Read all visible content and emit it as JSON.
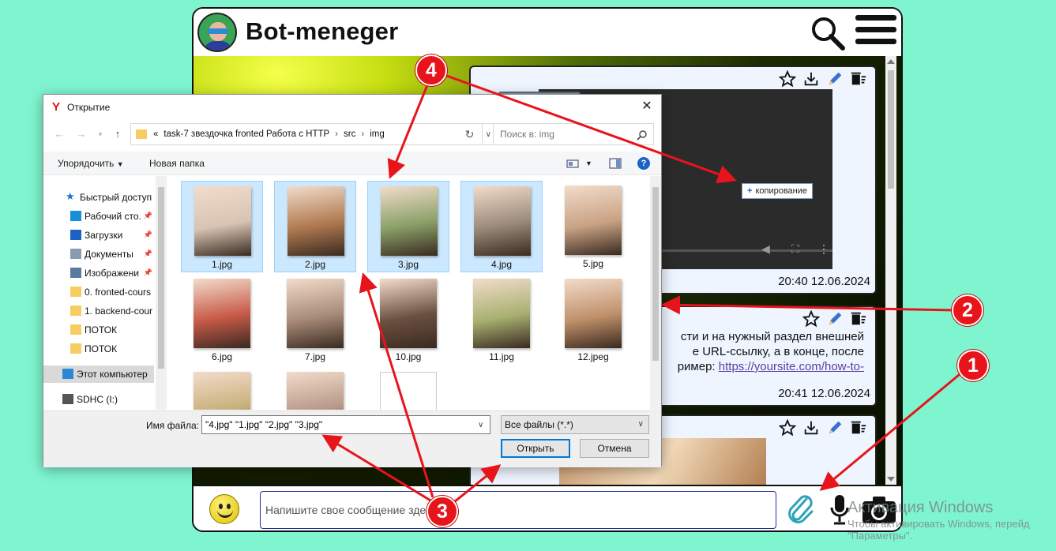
{
  "app": {
    "title": "Bot-meneger",
    "input_placeholder": "Напишите свое сообщение здесь",
    "icons": [
      "search-icon",
      "menu-icon",
      "smiley-icon",
      "paperclip-icon",
      "microphone-icon",
      "camera-icon"
    ]
  },
  "messages": [
    {
      "time": "20:40 12.06.2024",
      "content": "video"
    },
    {
      "text_line1": "сти и на нужный раздел внешней",
      "text_line2": "е URL-ссылку, а в конце, после",
      "text_line3_prefix": "ример: ",
      "text_line3_link": "https://yoursite.com/how-to-",
      "time": "20:41 12.06.2024"
    },
    {
      "content": "photo"
    }
  ],
  "drag": {
    "count": "4",
    "label": "копирование"
  },
  "dialog": {
    "title": "Открытие",
    "breadcrumb": [
      "«",
      "task-7 звездочка fronted Работа с HTTP",
      "src",
      "img"
    ],
    "search_placeholder": "Поиск в: img",
    "organize": "Упорядочить",
    "new_folder": "Новая папка",
    "sidebar": [
      {
        "label": "Быстрый доступ",
        "icon": "star-icon",
        "pinned": false
      },
      {
        "label": "Рабочий сто.",
        "icon": "desktop-icon",
        "pinned": true
      },
      {
        "label": "Загрузки",
        "icon": "downloads-icon",
        "pinned": true
      },
      {
        "label": "Документы",
        "icon": "documents-icon",
        "pinned": true
      },
      {
        "label": "Изображени",
        "icon": "pictures-icon",
        "pinned": true
      },
      {
        "label": "0. fronted-cours",
        "icon": "folder-icon",
        "pinned": false
      },
      {
        "label": "1. backend-cour",
        "icon": "folder-icon",
        "pinned": false
      },
      {
        "label": "ПОТОК",
        "icon": "folder-icon",
        "pinned": false
      },
      {
        "label": "ПОТОК",
        "icon": "folder-icon",
        "pinned": false
      },
      {
        "label": "Этот компьютер",
        "icon": "computer-icon",
        "pinned": false,
        "selected": true
      },
      {
        "label": "SDHC (I:)",
        "icon": "sd-card-icon",
        "pinned": false
      }
    ],
    "files": [
      {
        "name": "1.jpg",
        "selected": true,
        "tone": "#d8c4b4"
      },
      {
        "name": "2.jpg",
        "selected": true,
        "tone": "#b07a50"
      },
      {
        "name": "3.jpg",
        "selected": true,
        "tone": "#8aa068"
      },
      {
        "name": "4.jpg",
        "selected": true,
        "tone": "#9a8a7a"
      },
      {
        "name": "5.jpg",
        "selected": false,
        "tone": "#c9a284"
      },
      {
        "name": "6.jpg",
        "selected": false,
        "tone": "#c85a48"
      },
      {
        "name": "7.jpg",
        "selected": false,
        "tone": "#a88a78"
      },
      {
        "name": "10.jpg",
        "selected": false,
        "tone": "#6a5040"
      },
      {
        "name": "11.jpg",
        "selected": false,
        "tone": "#a8b070"
      },
      {
        "name": "12.jpeg",
        "selected": false,
        "tone": "#c0906a"
      },
      {
        "name": "",
        "selected": false,
        "tone": "#c8b07a"
      },
      {
        "name": "",
        "selected": false,
        "tone": "#b89888"
      },
      {
        "name": "",
        "selected": false,
        "tone": "blank"
      }
    ],
    "filename_label": "Имя файла:",
    "filename_value": "\"4.jpg\" \"1.jpg\" \"2.jpg\" \"3.jpg\"",
    "filter": "Все файлы (*.*)",
    "open_label": "Открыть",
    "cancel_label": "Отмена"
  },
  "annotations": [
    "1",
    "2",
    "3",
    "4"
  ],
  "annotation_color": "#e8141b",
  "watermark": {
    "line1": "Активация Windows",
    "line2": "Чтобы активировать Windows, перейд",
    "line3": "\"Параметры\"."
  }
}
